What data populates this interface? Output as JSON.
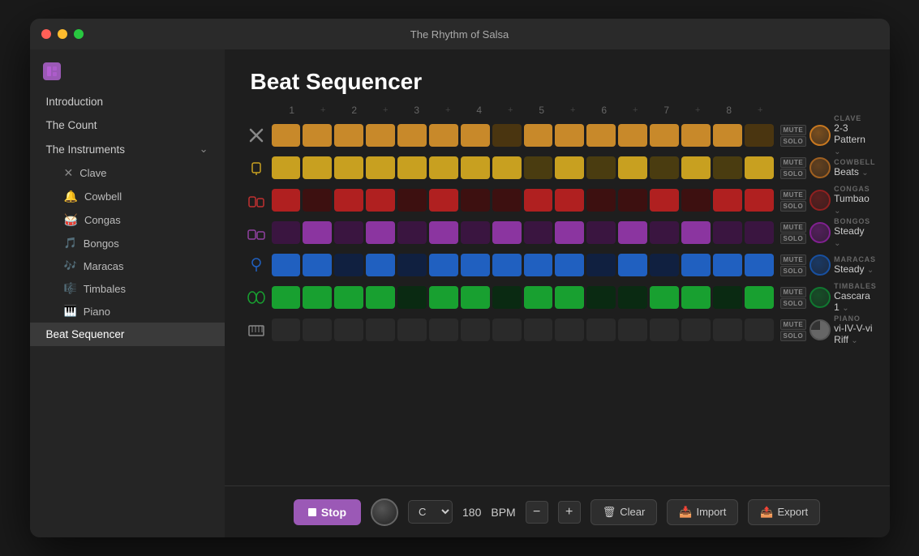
{
  "window": {
    "title": "The Rhythm of Salsa"
  },
  "sidebar": {
    "icon_label": "sidebar-icon",
    "items": [
      {
        "id": "introduction",
        "label": "Introduction",
        "active": false,
        "indent": 0
      },
      {
        "id": "the-count",
        "label": "The Count",
        "active": false,
        "indent": 0
      },
      {
        "id": "the-instruments",
        "label": "The Instruments",
        "active": false,
        "indent": 0,
        "expandable": true
      },
      {
        "id": "clave",
        "label": "Clave",
        "active": false,
        "indent": 1
      },
      {
        "id": "cowbell",
        "label": "Cowbell",
        "active": false,
        "indent": 1
      },
      {
        "id": "congas",
        "label": "Congas",
        "active": false,
        "indent": 1
      },
      {
        "id": "bongos",
        "label": "Bongos",
        "active": false,
        "indent": 1
      },
      {
        "id": "maracas",
        "label": "Maracas",
        "active": false,
        "indent": 1
      },
      {
        "id": "timbales",
        "label": "Timbales",
        "active": false,
        "indent": 1
      },
      {
        "id": "piano",
        "label": "Piano",
        "active": false,
        "indent": 1
      },
      {
        "id": "beat-sequencer",
        "label": "Beat Sequencer",
        "active": true,
        "indent": 0
      }
    ]
  },
  "main": {
    "title": "Beat Sequencer",
    "beat_numbers": [
      "1",
      "+",
      "2",
      "+",
      "3",
      "+",
      "4",
      "+",
      "5",
      "+",
      "6",
      "+",
      "7",
      "+",
      "8",
      "+"
    ]
  },
  "tracks": [
    {
      "id": "clave",
      "instrument": "CLAVE",
      "pattern": "2-3 Pattern",
      "knob_color": "#c87820",
      "cells": [
        1,
        0,
        1,
        0,
        1,
        0,
        1,
        0,
        1,
        1,
        1,
        0,
        1,
        0,
        1,
        0
      ],
      "type": "clave"
    },
    {
      "id": "cowbell",
      "instrument": "COWBELL",
      "pattern": "Beats",
      "knob_color": "#a06020",
      "cells": [
        1,
        1,
        1,
        1,
        1,
        1,
        1,
        1,
        0,
        1,
        0,
        1,
        0,
        1,
        0,
        1
      ],
      "type": "cowbell"
    },
    {
      "id": "congas",
      "instrument": "CONGAS",
      "pattern": "Tumbao",
      "knob_color": "#902020",
      "cells": [
        0,
        1,
        0,
        1,
        1,
        0,
        1,
        1,
        0,
        1,
        0,
        0,
        1,
        0,
        1,
        1
      ],
      "type": "congas"
    },
    {
      "id": "bongos",
      "instrument": "BONGOS",
      "pattern": "Steady",
      "knob_color": "#802090",
      "cells": [
        0,
        1,
        0,
        1,
        0,
        1,
        0,
        1,
        0,
        1,
        0,
        1,
        0,
        1,
        0,
        0
      ],
      "type": "bongos"
    },
    {
      "id": "maracas",
      "instrument": "MARACAS",
      "pattern": "Steady",
      "knob_color": "#1850a0",
      "cells": [
        1,
        1,
        0,
        1,
        0,
        1,
        1,
        0,
        1,
        1,
        0,
        1,
        0,
        1,
        1,
        1
      ],
      "type": "maracas"
    },
    {
      "id": "timbales",
      "instrument": "TIMBALES",
      "pattern": "Cascara 1",
      "knob_color": "#107830",
      "cells": [
        1,
        1,
        1,
        1,
        1,
        1,
        1,
        1,
        0,
        1,
        0,
        0,
        1,
        0,
        0,
        1
      ],
      "type": "timbales"
    },
    {
      "id": "piano",
      "instrument": "PIANO",
      "pattern": "vi-IV-V-vi Riff",
      "knob_color": "#555",
      "cells": [
        0,
        0,
        0,
        0,
        0,
        0,
        0,
        0,
        0,
        0,
        0,
        0,
        0,
        0,
        0,
        0
      ],
      "type": "piano"
    }
  ],
  "toolbar": {
    "stop_label": "Stop",
    "key": "C",
    "bpm": "180",
    "bpm_unit": "BPM",
    "clear_label": "Clear",
    "import_label": "Import",
    "export_label": "Export"
  },
  "mute_label": "MUTE",
  "solo_label": "SOLO"
}
